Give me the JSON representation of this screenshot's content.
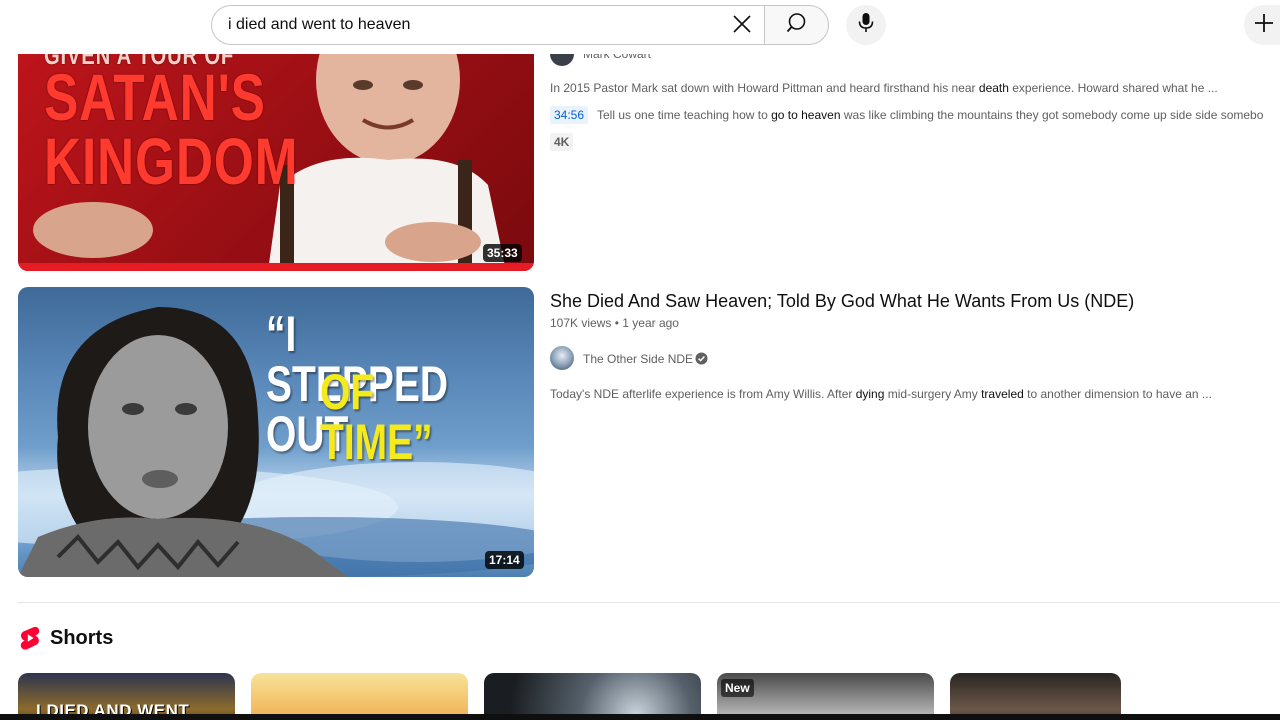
{
  "search": {
    "query": "i died and went to heaven"
  },
  "results": [
    {
      "thumbnail_text": [
        "GIVEN A TOUR OF",
        "SATAN'S",
        "KINGDOM"
      ],
      "duration": "35:33",
      "channel": "Mark Cowart",
      "description_parts": [
        {
          "text": "In 2015 Pastor Mark sat down with Howard Pittman and heard firsthand his near ",
          "bold": false
        },
        {
          "text": "death",
          "bold": true
        },
        {
          "text": " experience. Howard shared what he ...",
          "bold": false
        }
      ],
      "chapter_time": "34:56",
      "chapter_parts": [
        {
          "text": "Tell us one time teaching how to ",
          "bold": false
        },
        {
          "text": "go to heaven",
          "bold": true
        },
        {
          "text": " was like climbing the mountains they got somebody come up side side somebo",
          "bold": false
        }
      ],
      "badge": "4K"
    },
    {
      "thumbnail_text": [
        "“I STEPPED OUT",
        "OF TIME”"
      ],
      "duration": "17:14",
      "title": "She Died And Saw Heaven; Told By God What He Wants From Us (NDE)",
      "views": "107K views",
      "age": "1 year ago",
      "channel": "The Other Side NDE",
      "verified": true,
      "description_parts": [
        {
          "text": "Today's NDE afterlife experience is from Amy Willis. After ",
          "bold": false
        },
        {
          "text": "dying",
          "bold": true
        },
        {
          "text": " mid-surgery Amy ",
          "bold": false
        },
        {
          "text": "traveled",
          "bold": true
        },
        {
          "text": " to another dimension to have an ...",
          "bold": false
        }
      ]
    }
  ],
  "shorts": {
    "title": "Shorts",
    "items": [
      {
        "overlay_text": "I DIED AND WENT",
        "badge": ""
      },
      {
        "overlay_text": "",
        "badge": ""
      },
      {
        "overlay_text": "",
        "badge": ""
      },
      {
        "overlay_text": "",
        "badge": "New"
      },
      {
        "overlay_text": "",
        "badge": ""
      }
    ]
  },
  "colors": {
    "brand_red": "#ff0033",
    "chapter_blue": "#065fd4",
    "meta_gray": "#606060"
  }
}
